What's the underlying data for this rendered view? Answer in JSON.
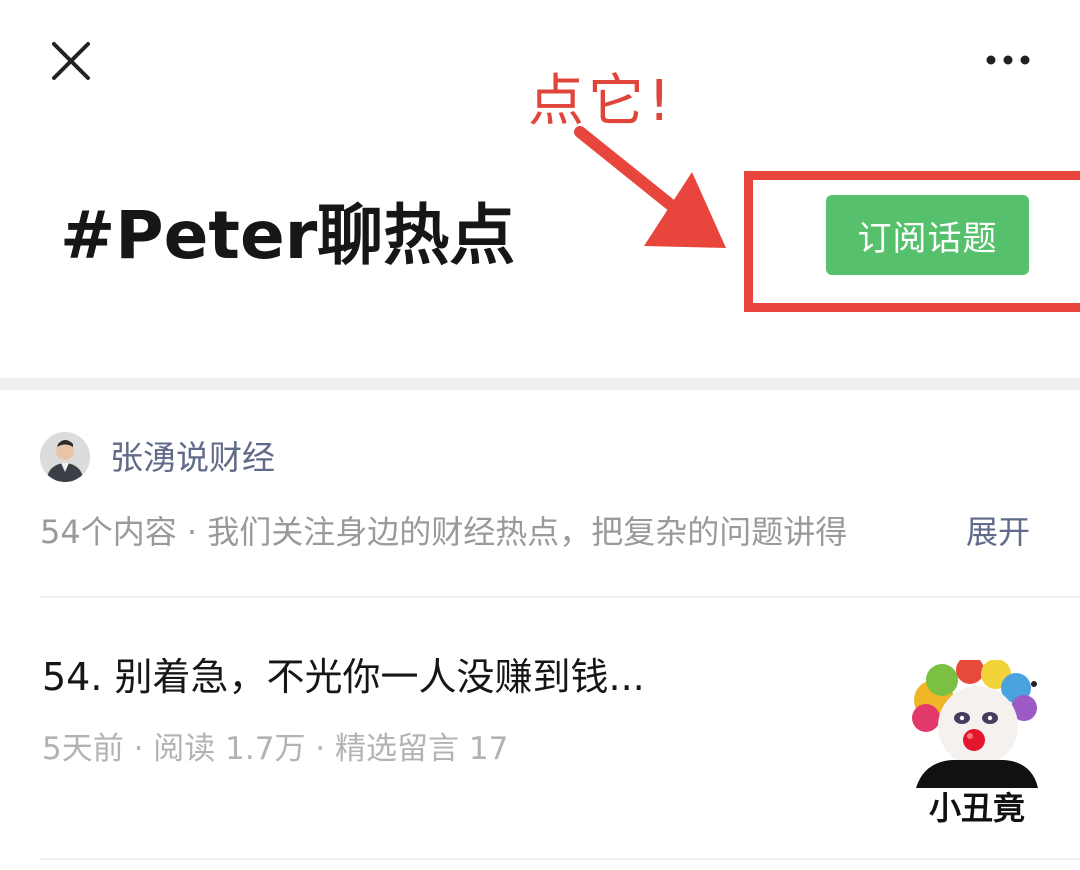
{
  "top_bar": {
    "close_icon": "close-icon",
    "more_icon": "more-horizontal-icon"
  },
  "annotation": {
    "text": "点它!",
    "color": "#e0453b"
  },
  "topic": {
    "title": "#Peter聊热点",
    "subscribe_label": "订阅话题",
    "subscribe_color": "#56c06c"
  },
  "author": {
    "name": "张湧说财经",
    "description": "54个内容 · 我们关注身边的财经热点，把复杂的问题讲得",
    "expand_label": "展开"
  },
  "articles": [
    {
      "title": "54. 别着急，不光你一人没赚到钱...",
      "meta": "5天前 · 阅读 1.7万 · 精选留言 17",
      "thumbnail_caption": "小丑竟"
    }
  ]
}
